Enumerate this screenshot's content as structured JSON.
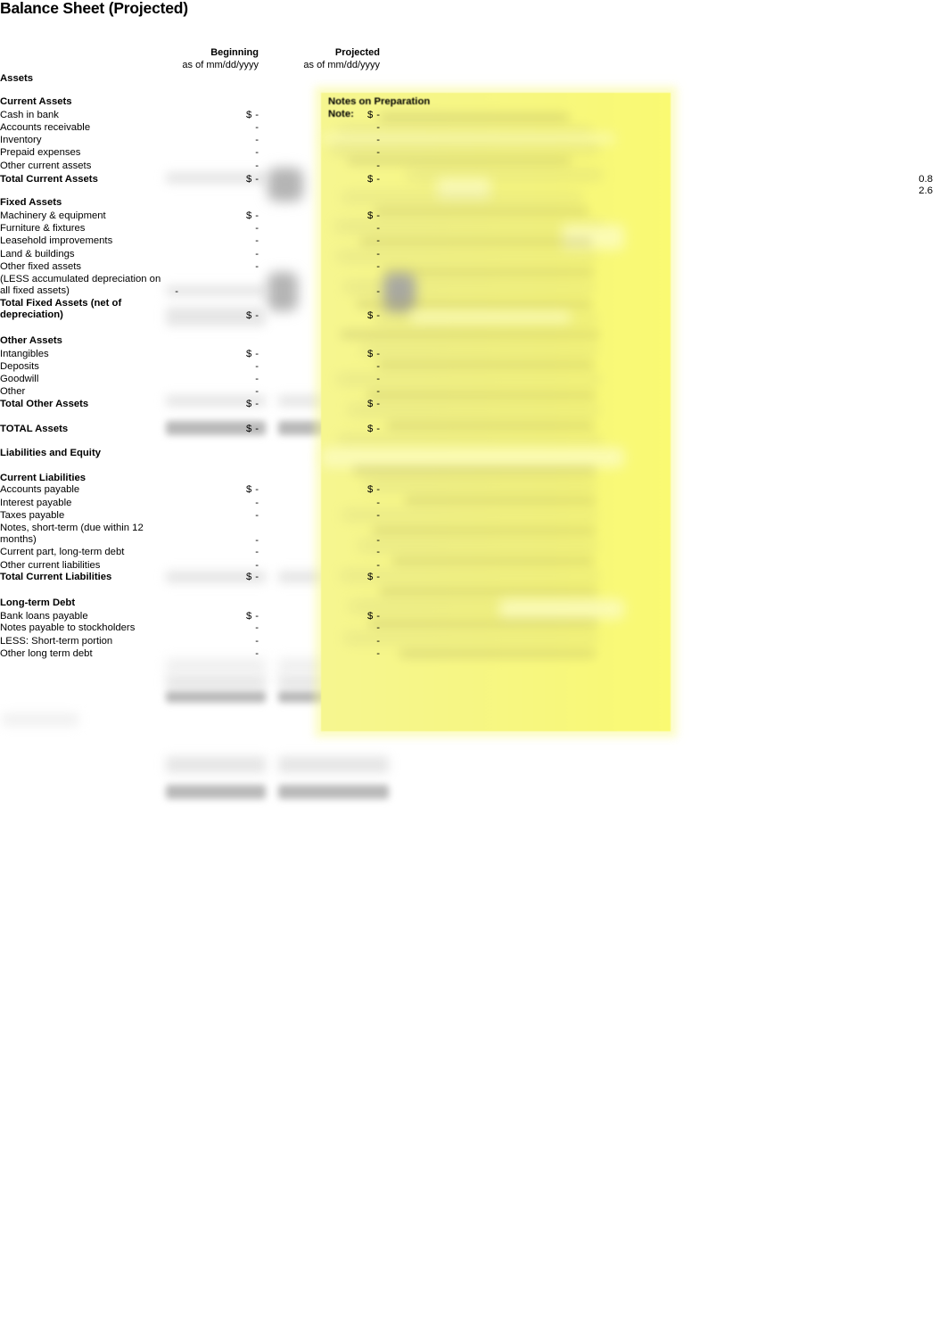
{
  "document": {
    "title": "Balance Sheet (Projected)"
  },
  "columns": {
    "beginning": {
      "title": "Beginning",
      "subtitle": "as of mm/dd/yyyy"
    },
    "projected": {
      "title": "Projected",
      "subtitle": "as of mm/dd/yyyy"
    }
  },
  "currency_symbol": "$",
  "zero_value": "-",
  "sections": {
    "assets_heading": "Assets",
    "current_assets": {
      "heading": "Current Assets",
      "rows": [
        {
          "label": "Cash in bank",
          "beginning": "-",
          "projected": "-",
          "currency": true
        },
        {
          "label": "Accounts receivable",
          "beginning": "-",
          "projected": "-",
          "currency": false
        },
        {
          "label": "Inventory",
          "beginning": "-",
          "projected": "-",
          "currency": false
        },
        {
          "label": "Prepaid expenses",
          "beginning": "-",
          "projected": "-",
          "currency": false
        },
        {
          "label": "Other current assets",
          "beginning": "-",
          "projected": "-",
          "currency": false
        }
      ],
      "total": {
        "label": "Total Current Assets",
        "beginning": "-",
        "projected": "-",
        "currency": true
      }
    },
    "fixed_assets": {
      "heading": "Fixed Assets",
      "rows": [
        {
          "label": "Machinery & equipment",
          "beginning": "-",
          "projected": "-",
          "currency": true
        },
        {
          "label": "Furniture & fixtures",
          "beginning": "-",
          "projected": "-",
          "currency": false
        },
        {
          "label": "Leasehold improvements",
          "beginning": "-",
          "projected": "-",
          "currency": false
        },
        {
          "label": "Land & buildings",
          "beginning": "-",
          "projected": "-",
          "currency": false
        },
        {
          "label": "Other fixed assets",
          "beginning": "-",
          "projected": "-",
          "currency": false
        },
        {
          "label": "(LESS accumulated depreciation on all fixed assets)",
          "beginning": "-",
          "projected": "-",
          "currency": false
        }
      ],
      "total": {
        "label": "Total Fixed Assets (net of depreciation)",
        "beginning": "-",
        "projected": "-",
        "currency": true
      }
    },
    "other_assets": {
      "heading": "Other Assets",
      "rows": [
        {
          "label": "Intangibles",
          "beginning": "-",
          "projected": "-",
          "currency": true
        },
        {
          "label": "Deposits",
          "beginning": "-",
          "projected": "-",
          "currency": false
        },
        {
          "label": "Goodwill",
          "beginning": "-",
          "projected": "-",
          "currency": false
        },
        {
          "label": "Other",
          "beginning": "-",
          "projected": "-",
          "currency": false
        }
      ],
      "total": {
        "label": "Total Other Assets",
        "beginning": "-",
        "projected": "-",
        "currency": true
      }
    },
    "total_assets": {
      "label": "TOTAL Assets",
      "beginning": "-",
      "projected": "-",
      "currency": true
    },
    "liabilities_heading": "Liabilities and Equity",
    "current_liabilities": {
      "heading": "Current Liabilities",
      "rows": [
        {
          "label": "Accounts payable",
          "beginning": "-",
          "projected": "-",
          "currency": true
        },
        {
          "label": "Interest payable",
          "beginning": "-",
          "projected": "-",
          "currency": false
        },
        {
          "label": "Taxes payable",
          "beginning": "-",
          "projected": "-",
          "currency": false
        },
        {
          "label": "Notes, short-term (due within 12 months)",
          "beginning": "-",
          "projected": "-",
          "currency": false
        },
        {
          "label": "Current part, long-term debt",
          "beginning": "-",
          "projected": "-",
          "currency": false
        },
        {
          "label": "Other current liabilities",
          "beginning": "-",
          "projected": "-",
          "currency": false
        }
      ],
      "total": {
        "label": "Total Current Liabilities",
        "beginning": "-",
        "projected": "-",
        "currency": true
      }
    },
    "long_term_debt": {
      "heading": "Long-term Debt",
      "rows": [
        {
          "label": "Bank loans payable",
          "beginning": "-",
          "projected": "-",
          "currency": true
        },
        {
          "label": "Notes payable to stockholders",
          "beginning": "-",
          "projected": "-",
          "currency": false
        },
        {
          "label": "LESS: Short-term portion",
          "beginning": "-",
          "projected": "-",
          "currency": false
        },
        {
          "label": "Other long term debt",
          "beginning": "-",
          "projected": "-",
          "currency": false
        }
      ]
    }
  },
  "notes_panel": {
    "title": "Notes on Preparation",
    "note_label": "Note:",
    "body_redacted": true
  },
  "ratios": {
    "values": [
      "0.8",
      "2.6"
    ]
  },
  "colors": {
    "note_panel_background": "#f6f68f",
    "page_background": "#ffffff",
    "text": "#000000",
    "redacted_cell": "#d9d9d9"
  }
}
